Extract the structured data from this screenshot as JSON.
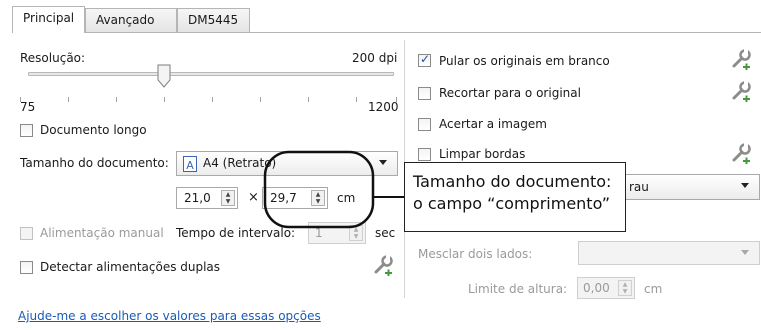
{
  "tabs": [
    {
      "label": "Principal",
      "active": true
    },
    {
      "label": "Avançado",
      "active": false
    },
    {
      "label": "DM5445",
      "active": false
    }
  ],
  "resolution": {
    "label": "Resolução:",
    "value_text": "200 dpi",
    "min_label": "75",
    "max_label": "1200",
    "value": 200,
    "min": 75,
    "max": 1200
  },
  "long_document": {
    "label": "Documento longo",
    "checked": false
  },
  "document_size": {
    "label": "Tamanho do documento:",
    "selected": "A4 (Retrato)",
    "width": "21,0",
    "height": "29,7",
    "times": "×",
    "unit": "cm"
  },
  "manual_feed": {
    "label": "Alimentação manual",
    "checked": false,
    "enabled": false
  },
  "interval": {
    "label": "Tempo de intervalo:",
    "value": "1",
    "unit": "sec"
  },
  "detect_double": {
    "label": "Detectar alimentações duplas",
    "checked": false
  },
  "right_options": [
    {
      "label": "Pular os originais em branco",
      "checked": true
    },
    {
      "label": "Recortar para o original",
      "checked": false
    },
    {
      "label": "Acertar a imagem",
      "checked": false
    },
    {
      "label": "Limpar bordas",
      "checked": false
    }
  ],
  "partial_combo": {
    "value_fragment": "rau"
  },
  "merge_sides": {
    "label": "Mesclar dois lados:",
    "value": ""
  },
  "height_limit": {
    "label": "Limite de altura:",
    "value": "0,00",
    "unit": "cm"
  },
  "help_link": "Ajude-me a escolher os valores para essas opções",
  "callout": {
    "line1": "Tamanho do documento:",
    "line2": "o campo “comprimento”"
  },
  "colors": {
    "accent": "#1a5bb8",
    "checkbox_check": "#1d4fa3"
  },
  "icons": [
    "wrench-icon",
    "document-icon",
    "spin-up-icon",
    "spin-down-icon",
    "chevron-down-icon"
  ]
}
